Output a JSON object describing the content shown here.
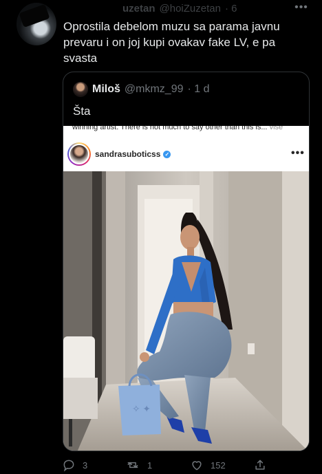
{
  "tweet": {
    "display_name": "uzetan",
    "handle": "@hoiZuzetan",
    "time": "· 6",
    "more_icon": "more-horizontal-icon",
    "text": "Oprostila debelom muzu sa parama javnu prevaru i on joj kupi ovakav fake LV, e pa svasta"
  },
  "quoted_tweet": {
    "display_name": "Miloš",
    "handle": "@mkmz_99",
    "time": "· 1 d",
    "text": "Šta",
    "instagram_post": {
      "cut_caption": "winning artist. There is not much to say other than this is...",
      "cut_more": "više",
      "username": "sandrasuboticss",
      "verified": true,
      "more_icon": "more-horizontal-icon"
    }
  },
  "actions": {
    "reply_count": "3",
    "retweet_count": "1",
    "like_count": "152",
    "icons": [
      "reply-icon",
      "retweet-icon",
      "like-icon",
      "share-icon"
    ]
  },
  "colors": {
    "background": "#000000",
    "text": "#e7e9ea",
    "muted": "#71767b",
    "border": "#2f3336",
    "verified": "#3897f0",
    "jacket": "#2e6fc7"
  }
}
